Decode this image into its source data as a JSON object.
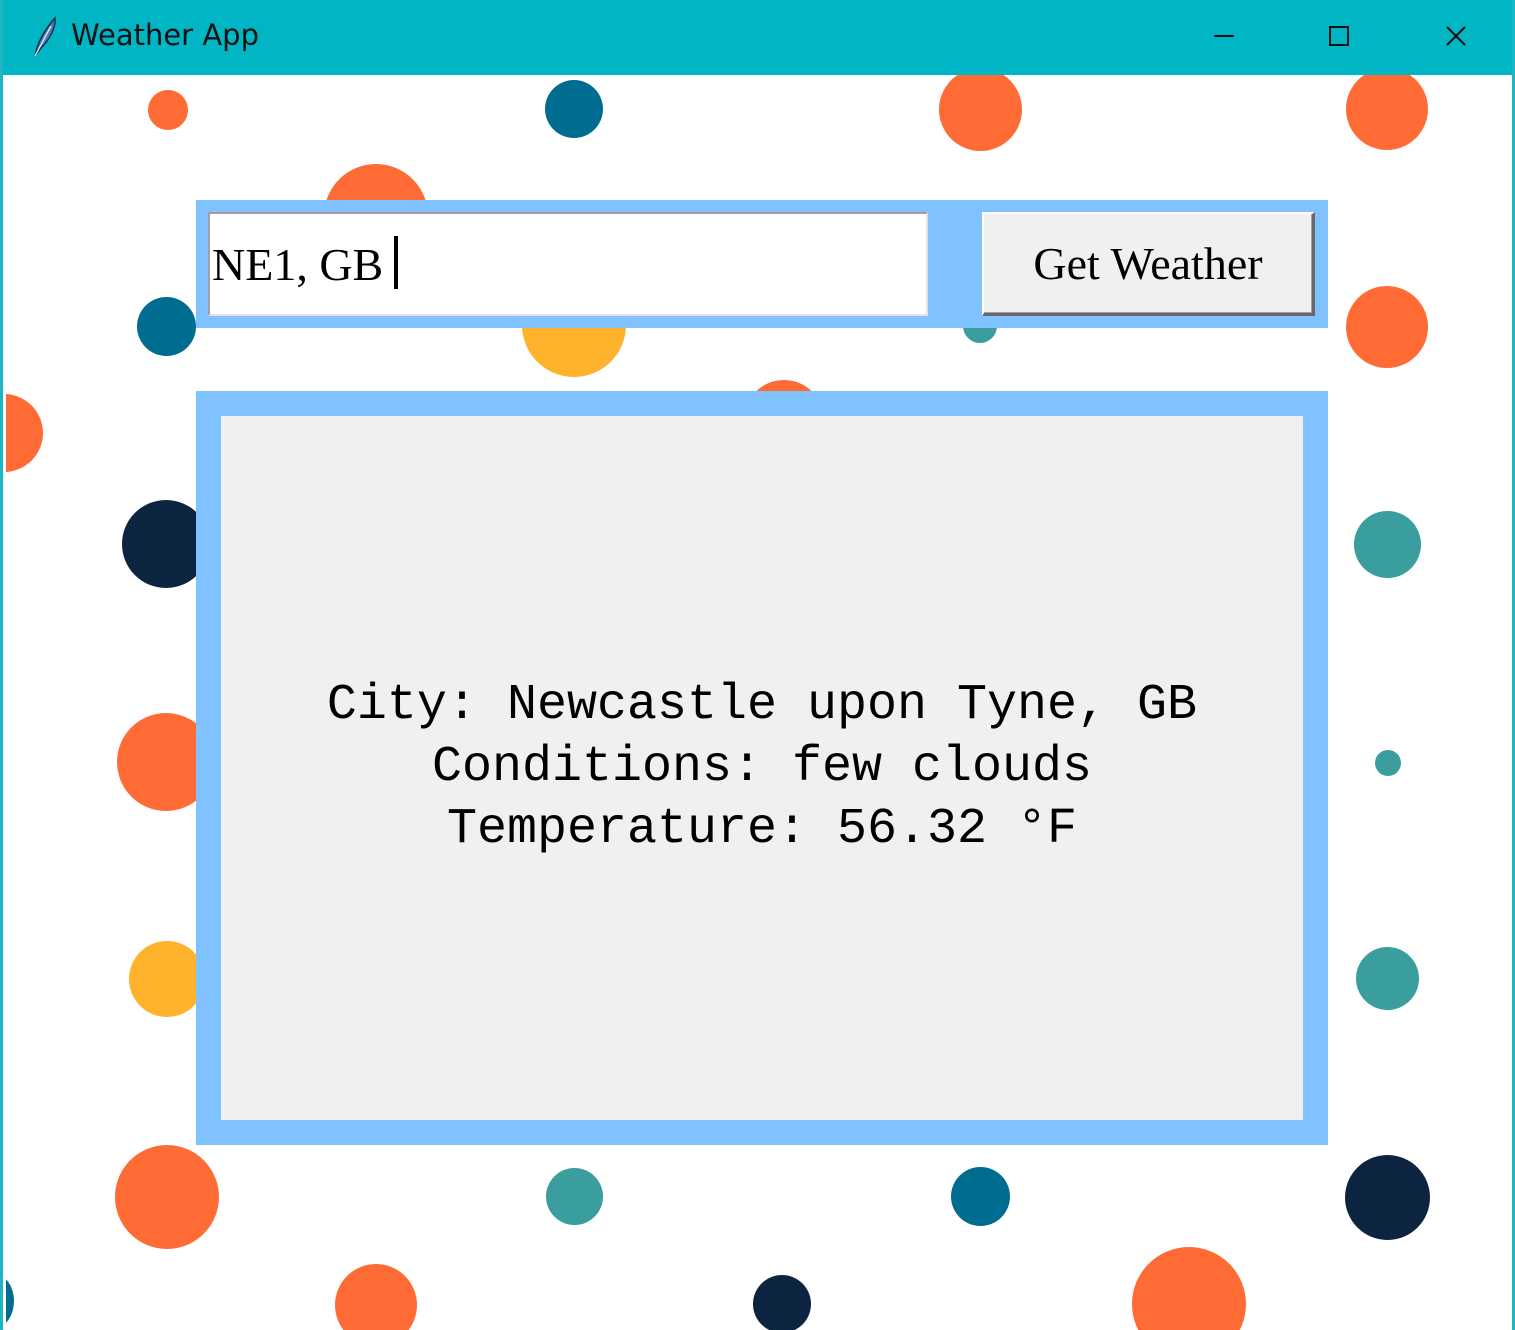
{
  "window": {
    "title": "Weather App",
    "icon": "feather-icon",
    "controls": [
      "minimize-icon",
      "maximize-icon",
      "close-icon"
    ]
  },
  "search": {
    "value": "NE1, GB",
    "button_label": "Get Weather"
  },
  "result": {
    "city_line": "City: Newcastle upon Tyne, GB",
    "conditions_line": "Conditions: few clouds",
    "temperature_line": "Temperature: 56.32 °F"
  },
  "colors": {
    "titlebar": "#00b6c4",
    "frame": "#80c1ff",
    "panel": "#f0f0f0",
    "dot_orange": "#ff6b35",
    "dot_blue": "#006c8f",
    "dot_navy": "#0d2440",
    "dot_teal": "#3a9e9e",
    "dot_yellow": "#ffb22b"
  }
}
